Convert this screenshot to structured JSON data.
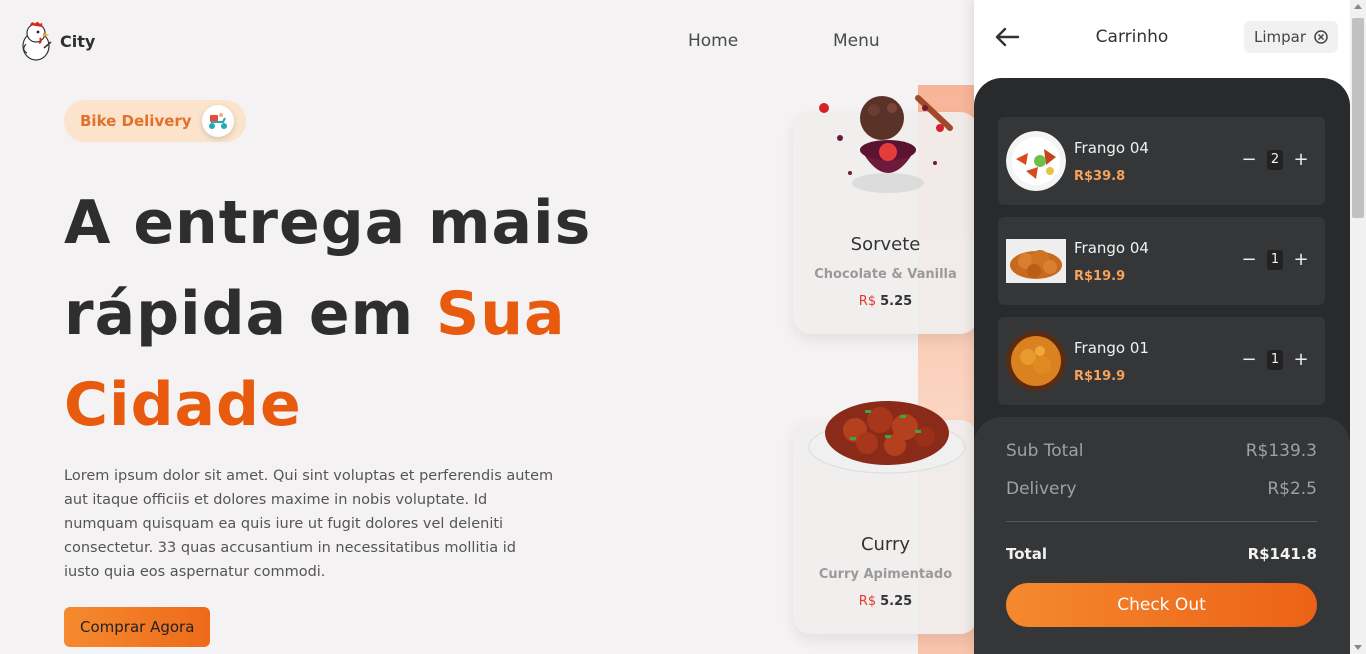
{
  "header": {
    "brand": "City",
    "logo_icon": "chicken-mascot-icon",
    "nav": [
      {
        "label": "Home"
      },
      {
        "label": "Menu"
      }
    ]
  },
  "hero": {
    "badge": {
      "label": "Bike Delivery",
      "icon": "delivery-scooter-icon"
    },
    "title_line1": "A entrega mais",
    "title_line2": "rápida em",
    "title_accent_1": "Sua",
    "title_accent_2": "Cidade",
    "description": "Lorem ipsum dolor sit amet. Qui sint voluptas et perferendis autem aut itaque officiis et dolores maxime in nobis voluptate. Id numquam quisquam ea quis iure ut fugit dolores vel deleniti consectetur. 33 quas accusantium in necessitatibus mollitia id iusto quia eos aspernatur commodi.",
    "cta": "Comprar Agora"
  },
  "cards": [
    {
      "name": "Sorvete",
      "description": "Chocolate & Vanilla",
      "currency": "R$",
      "price": "5.25"
    },
    {
      "name": "Curry",
      "description": "Curry Apimentado",
      "currency": "R$",
      "price": "5.25"
    }
  ],
  "cart": {
    "title": "Carrinho",
    "clear_label": "Limpar",
    "items": [
      {
        "name": "Frango 04",
        "price": "R$39.8",
        "qty": "2"
      },
      {
        "name": "Frango 04",
        "price": "R$19.9",
        "qty": "1"
      },
      {
        "name": "Frango 01",
        "price": "R$19.9",
        "qty": "1"
      }
    ],
    "summary": {
      "subtotal_label": "Sub Total",
      "subtotal_value": "R$139.3",
      "delivery_label": "Delivery",
      "delivery_value": "R$2.5",
      "total_label": "Total",
      "total_value": "R$141.8"
    },
    "checkout_label": "Check Out"
  },
  "colors": {
    "accent": "#e85a0e",
    "cart_bg": "#282a2c",
    "cart_item_bg": "#343638",
    "price_accent": "#f7a15a"
  }
}
